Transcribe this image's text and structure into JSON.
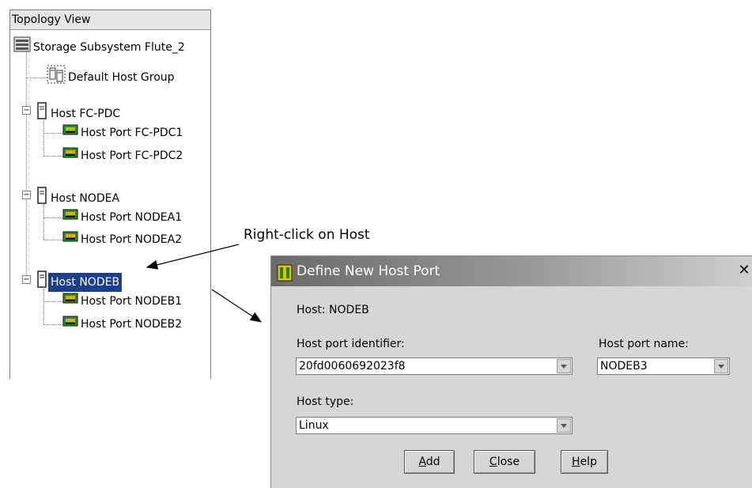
{
  "topology": {
    "header": "Topology View",
    "items": [
      {
        "label": "Storage Subsystem Flute_2",
        "icon": "storage-subsystem-icon"
      },
      {
        "label": "Default Host Group",
        "icon": "host-group-icon"
      },
      {
        "label": "Host FC-PDC",
        "icon": "host-icon"
      },
      {
        "label": "Host Port FC-PDC1",
        "icon": "host-port-icon"
      },
      {
        "label": "Host Port FC-PDC2",
        "icon": "host-port-icon"
      },
      {
        "label": "Host NODEA",
        "icon": "host-icon"
      },
      {
        "label": "Host Port NODEA1",
        "icon": "host-port-icon"
      },
      {
        "label": "Host Port NODEA2",
        "icon": "host-port-icon"
      },
      {
        "label": "Host NODEB",
        "icon": "host-icon",
        "selected": true
      },
      {
        "label": "Host Port NODEB1",
        "icon": "host-port-icon"
      },
      {
        "label": "Host Port NODEB2",
        "icon": "host-port-icon"
      }
    ]
  },
  "annotation": "Right-click on Host",
  "dialog": {
    "title": "Define New Host Port",
    "close_glyph": "✕",
    "host_label": "Host: NODEB",
    "port_identifier_label": "Host port identifier:",
    "port_identifier_value": "20fd0060692023f8",
    "port_name_label": "Host port name:",
    "port_name_value": "NODEB3",
    "host_type_label": "Host type:",
    "host_type_value": "Linux",
    "buttons": {
      "add": {
        "mnemonic": "A",
        "rest": "dd"
      },
      "close": {
        "mnemonic": "C",
        "rest": "lose"
      },
      "help": {
        "mnemonic": "H",
        "rest": "elp"
      }
    }
  },
  "colors": {
    "selection": "#1b3f8b",
    "dialog_bg": "#d6d6d6"
  }
}
